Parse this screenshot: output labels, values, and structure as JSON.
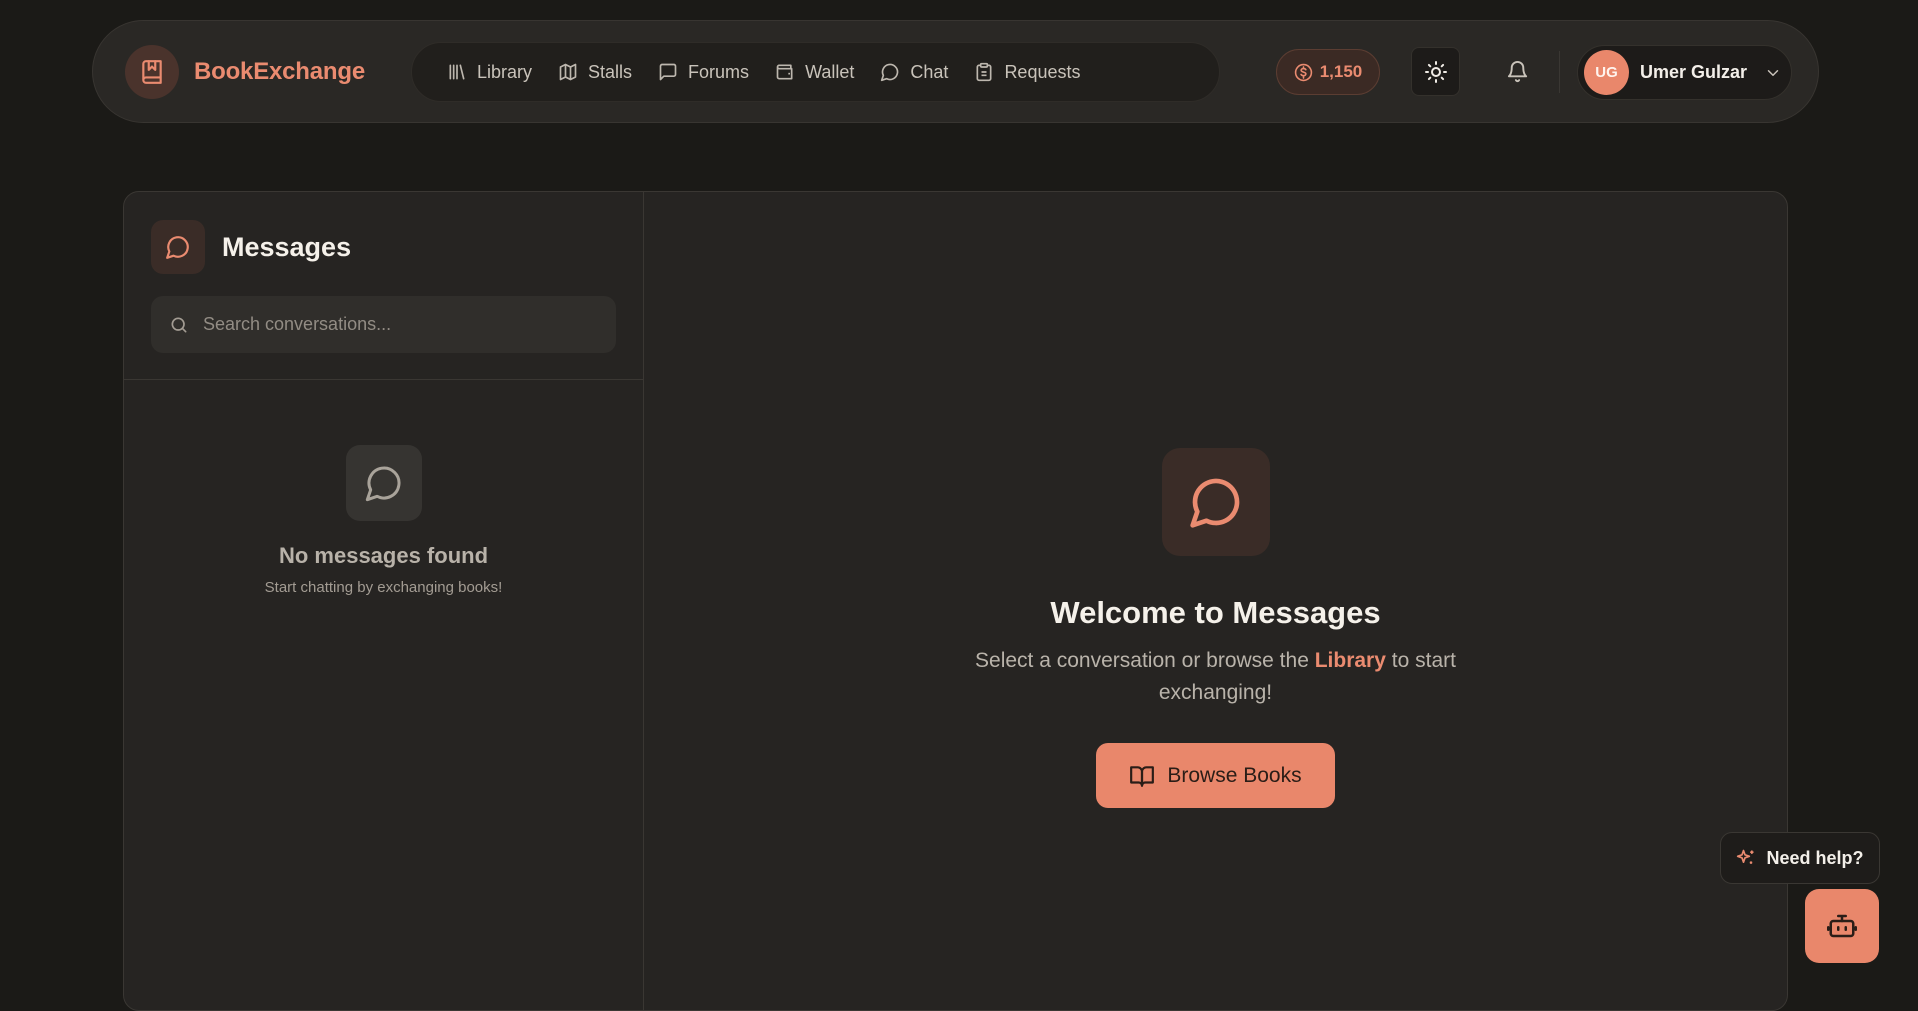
{
  "brand": {
    "name": "BookExchange",
    "icon": "book-bookmark-icon"
  },
  "nav": {
    "items": [
      {
        "label": "Library",
        "icon": "library-icon"
      },
      {
        "label": "Stalls",
        "icon": "map-icon"
      },
      {
        "label": "Forums",
        "icon": "message-square-icon"
      },
      {
        "label": "Wallet",
        "icon": "wallet-icon"
      },
      {
        "label": "Chat",
        "icon": "chat-bubble-icon"
      },
      {
        "label": "Requests",
        "icon": "clipboard-icon"
      }
    ]
  },
  "header": {
    "coins": "1,150",
    "user": {
      "initials": "UG",
      "name": "Umer Gulzar"
    }
  },
  "messages": {
    "title": "Messages",
    "search_placeholder": "Search conversations...",
    "empty_title": "No messages found",
    "empty_subtitle": "Start chatting by exchanging books!"
  },
  "welcome": {
    "title": "Welcome to Messages",
    "text_before": "Select a conversation or browse the ",
    "link": "Library",
    "text_after": " to start exchanging!",
    "button": "Browse Books"
  },
  "help": {
    "label": "Need help?"
  },
  "colors": {
    "accent": "#e9876b",
    "background": "#1b1a17",
    "surface": "#262422"
  }
}
